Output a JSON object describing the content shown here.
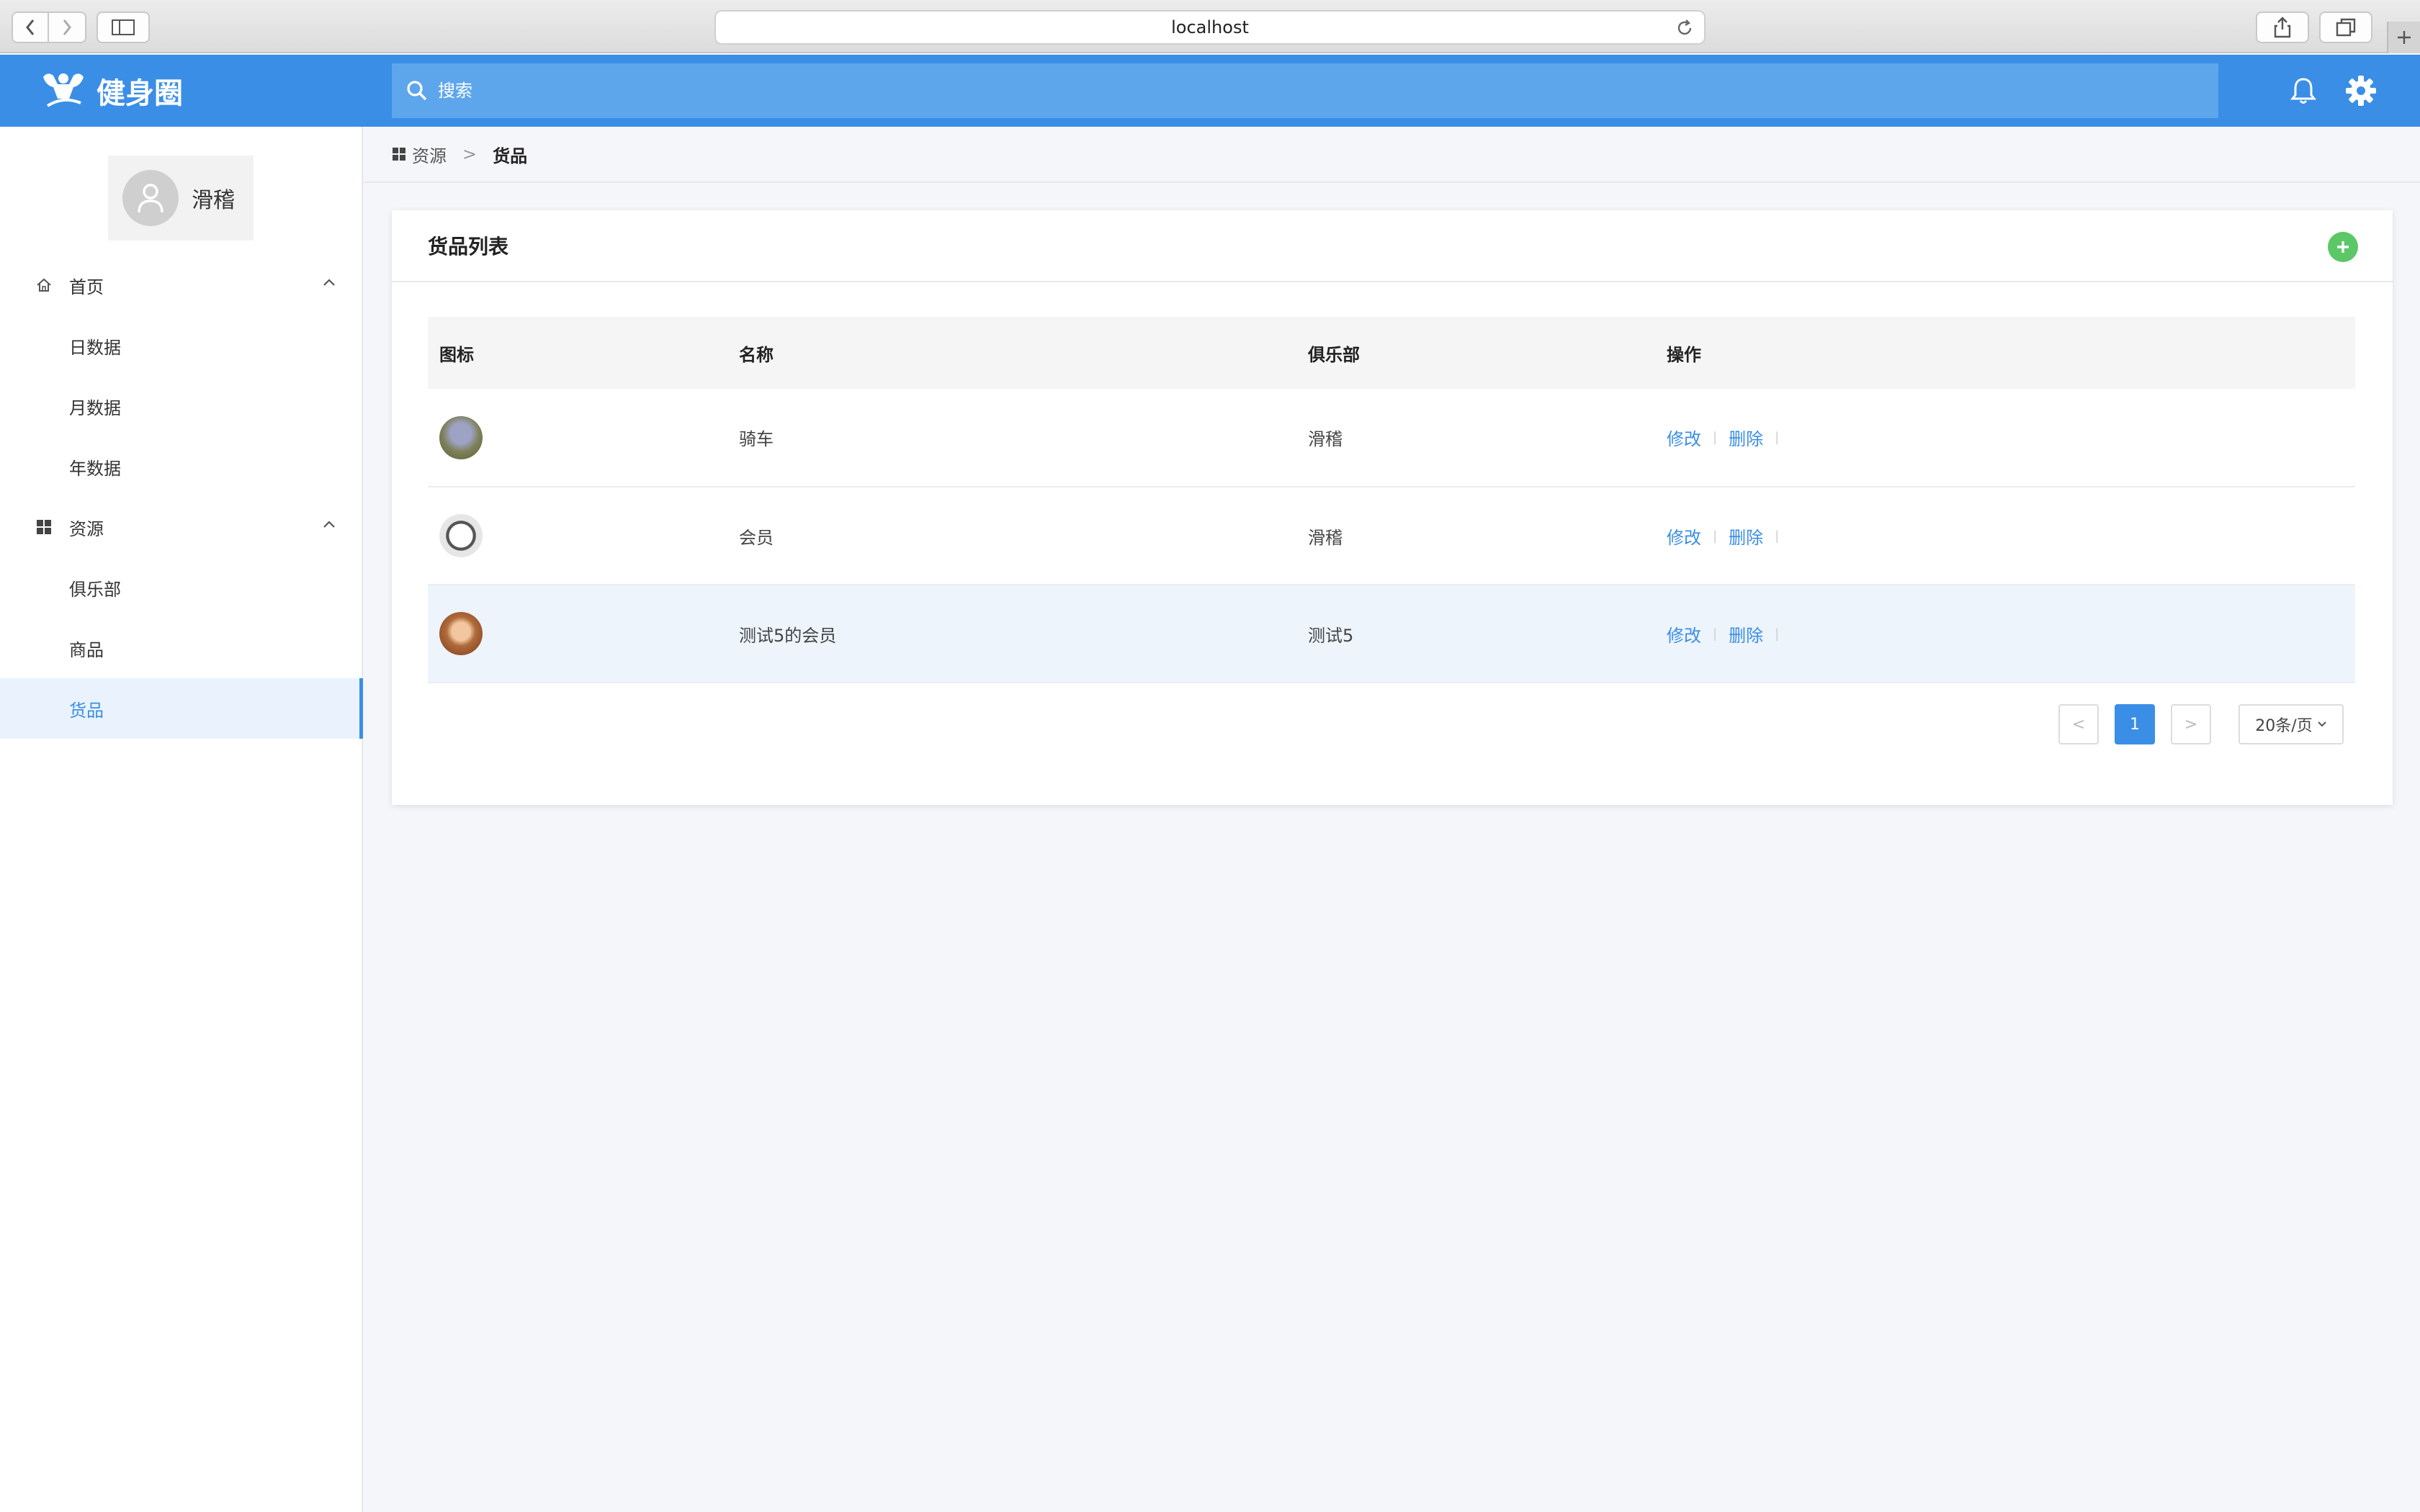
{
  "browser": {
    "url": "localhost"
  },
  "header": {
    "app_name": "健身圈",
    "search_placeholder": "搜索",
    "colors": {
      "primary": "#3a8ee6",
      "search_bg": "#5ea6ec",
      "add_green": "#5cc767"
    }
  },
  "user": {
    "name": "滑稽"
  },
  "sidebar": {
    "groups": [
      {
        "label": "首页",
        "icon": "home-icon",
        "items": [
          "日数据",
          "月数据",
          "年数据"
        ]
      },
      {
        "label": "资源",
        "icon": "grid-icon",
        "items": [
          "俱乐部",
          "商品",
          "货品"
        ]
      }
    ],
    "active_item": "货品"
  },
  "breadcrumb": {
    "parent": "资源",
    "separator": ">",
    "current": "货品"
  },
  "card": {
    "title": "货品列表"
  },
  "table": {
    "columns": [
      "图标",
      "名称",
      "俱乐部",
      "操作"
    ],
    "rows": [
      {
        "icon": "rabbit-avatar",
        "name": "骑车",
        "club": "滑稽",
        "edit": "修改",
        "delete": "删除"
      },
      {
        "icon": "dog-avatar",
        "name": "会员",
        "club": "滑稽",
        "edit": "修改",
        "delete": "删除"
      },
      {
        "icon": "squirrel-avatar",
        "name": "测试5的会员",
        "club": "测试5",
        "edit": "修改",
        "delete": "删除"
      }
    ]
  },
  "pagination": {
    "prev": "<",
    "current_page": "1",
    "next": ">",
    "page_size": "20条/页"
  }
}
